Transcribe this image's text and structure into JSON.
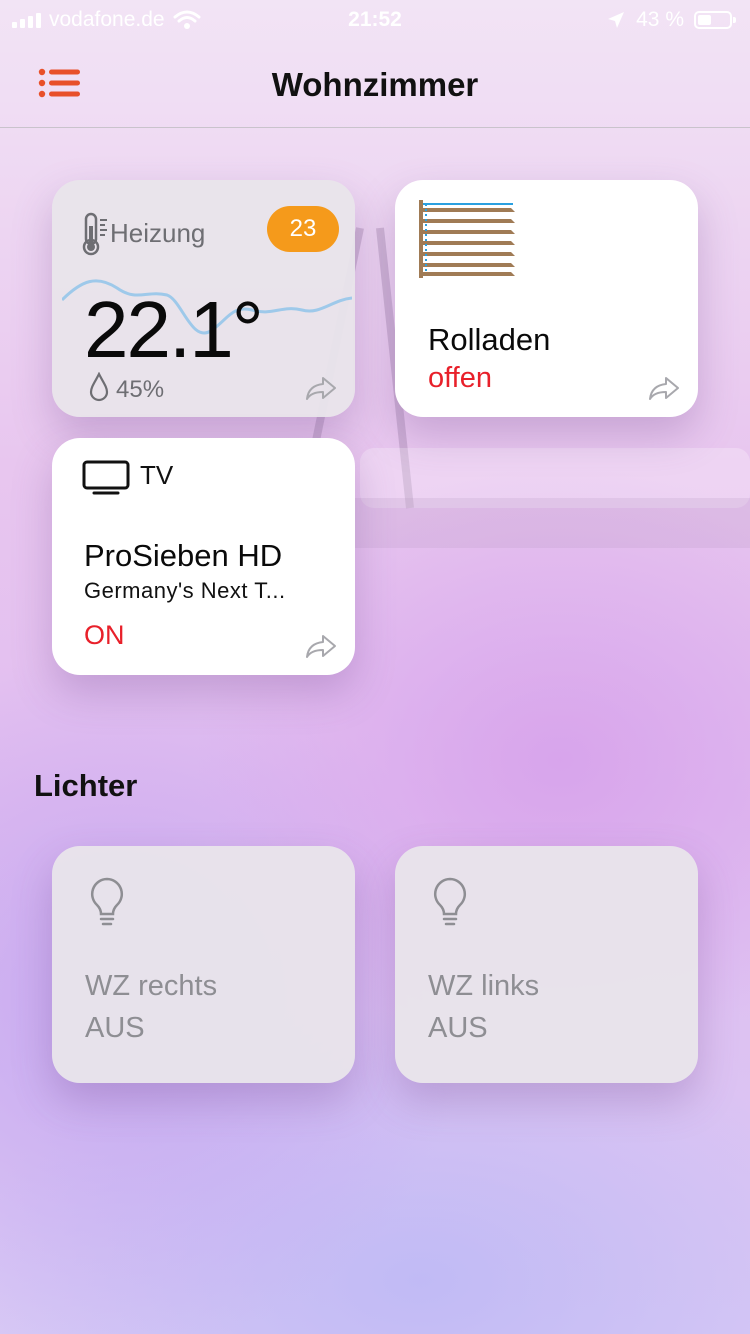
{
  "status_bar": {
    "carrier": "vodafone.de",
    "time": "21:52",
    "battery": "43 %",
    "battery_level": 0.43
  },
  "nav": {
    "title": "Wohnzimmer",
    "menu_icon": "list-icon",
    "accent_color": "#e8502a"
  },
  "tiles": {
    "heating": {
      "label": "Heizung",
      "target": "23",
      "temperature": "22.1°",
      "humidity": "45%",
      "badge_color": "#f59a1b"
    },
    "blinds": {
      "title": "Rolladen",
      "status": "offen"
    },
    "tv": {
      "label": "TV",
      "channel": "ProSieben HD",
      "show": "Germany's Next T...",
      "status": "ON"
    }
  },
  "lights": {
    "section_title": "Lichter",
    "items": [
      {
        "name": "WZ rechts",
        "status": "AUS"
      },
      {
        "name": "WZ links",
        "status": "AUS"
      }
    ]
  },
  "colors": {
    "status_red": "#e8202a",
    "muted_text": "#8e8e93"
  }
}
